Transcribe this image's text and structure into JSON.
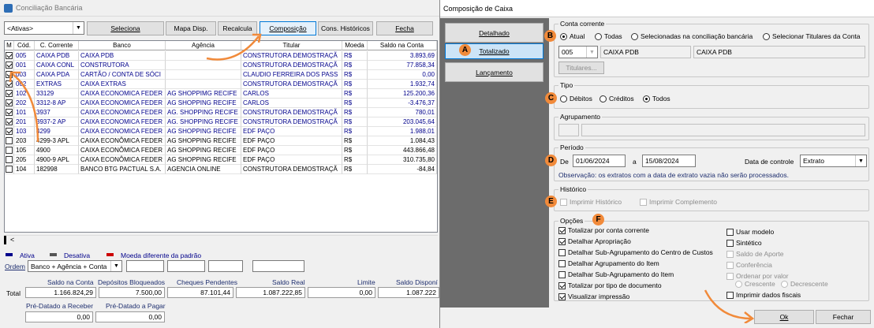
{
  "left_window": {
    "title": "Conciliação Bancária",
    "filter_select": "<Ativas>",
    "toolbar": {
      "seleciona": "Seleciona",
      "mapa_disp": "Mapa Disp.",
      "recalcula": "Recalcula",
      "composicao": "Composição",
      "cons_historicos": "Cons. Históricos",
      "fecha": "Fecha"
    },
    "grid": {
      "headers": [
        "M",
        "Cód.",
        "C. Corrente",
        "Banco",
        "Agência",
        "Titular",
        "Moeda",
        "Saldo na Conta"
      ],
      "rows": [
        {
          "checked": true,
          "cod": "005",
          "cc": "CAIXA PDB",
          "banco": "CAIXA PDB",
          "agencia": "",
          "titular": "CONSTRUTORA DEMOSTRAÇÃ",
          "moeda": "R$",
          "saldo": "3.893,69",
          "blue": true
        },
        {
          "checked": true,
          "cod": "001",
          "cc": "CAIXA CONL",
          "banco": "CONSTRUTORA",
          "agencia": "",
          "titular": "CONSTRUTORA DEMOSTRAÇÃ",
          "moeda": "R$",
          "saldo": "77.858,34",
          "blue": true
        },
        {
          "checked": true,
          "cod": "003",
          "cc": "CAIXA PDA",
          "banco": "CARTÃO / CONTA DE SÓCI",
          "agencia": "",
          "titular": "CLAUDIO  FERREIRA DOS PASS",
          "moeda": "R$",
          "saldo": "0,00",
          "blue": true
        },
        {
          "checked": true,
          "cod": "002",
          "cc": "EXTRAS",
          "banco": "CAIXA EXTRAS",
          "agencia": "",
          "titular": "CONSTRUTORA DEMOSTRAÇÃ",
          "moeda": "R$",
          "saldo": "1.932,74",
          "blue": true
        },
        {
          "checked": true,
          "cod": "102",
          "cc": "33129",
          "banco": "CAIXA ECONOMICA FEDER",
          "agencia": "AG SHOPPIMG RECIFE",
          "titular": "CARLOS",
          "moeda": "R$",
          "saldo": "125.200,36",
          "blue": true
        },
        {
          "checked": true,
          "cod": "202",
          "cc": "3312-8 AP",
          "banco": "CAIXA ECONOMICA FEDER",
          "agencia": "AG SHOPPING RECIFE",
          "titular": "CARLOS",
          "moeda": "R$",
          "saldo": "-3.476,37",
          "blue": true
        },
        {
          "checked": true,
          "cod": "101",
          "cc": "3937",
          "banco": "CAIXA ECONOMICA FEDER",
          "agencia": "AG. SHOPPING RECIFE",
          "titular": "CONSTRUTORA DEMOSTRAÇÃ",
          "moeda": "R$",
          "saldo": "780,01",
          "blue": true
        },
        {
          "checked": true,
          "cod": "201",
          "cc": "3937-2 AP",
          "banco": "CAIXA ECONOMICA FEDER",
          "agencia": "AG. SHOPPING RECIFE",
          "titular": "CONSTRUTORA DEMOSTRAÇÃ",
          "moeda": "R$",
          "saldo": "203.045,64",
          "blue": true
        },
        {
          "checked": true,
          "cod": "103",
          "cc": "4299",
          "banco": "CAIXA ECONOMICA FEDER",
          "agencia": "AG SHOPPING RECIFE",
          "titular": "EDF PAÇO",
          "moeda": "R$",
          "saldo": "1.988,01",
          "blue": true
        },
        {
          "checked": false,
          "cod": "203",
          "cc": "4299-3 APL",
          "banco": "CAIXA ECONÔMICA FEDER",
          "agencia": "AG SHOPPING RECIFE",
          "titular": "EDF PAÇO",
          "moeda": "R$",
          "saldo": "1.084,43",
          "blue": false
        },
        {
          "checked": false,
          "cod": "105",
          "cc": "4900",
          "banco": "CAIXA ECONÔMICA FEDER",
          "agencia": "AG SHOPPING RECIFE",
          "titular": "EDF PAÇO",
          "moeda": "R$",
          "saldo": "443.866,48",
          "blue": false
        },
        {
          "checked": false,
          "cod": "205",
          "cc": "4900-9 APL",
          "banco": "CAIXA ECONÔMICA FEDER",
          "agencia": "AG SHOPPING RECIFE",
          "titular": "EDF PAÇO",
          "moeda": "R$",
          "saldo": "310.735,80",
          "blue": false
        },
        {
          "checked": false,
          "cod": "104",
          "cc": "182998",
          "banco": "BANCO BTG PACTUAL S.A.",
          "agencia": "AGENCIA ONLINE",
          "titular": "CONSTRUTORA DEMOSTRAÇÃ",
          "moeda": "R$",
          "saldo": "-84,84",
          "blue": false
        }
      ]
    },
    "scroll_left": "<",
    "legend": {
      "ativa": "Ativa",
      "desativa": "Desativa",
      "moeda": "Moeda diferente da padrão"
    },
    "ordem_label": "Ordem",
    "ordem_value": "Banco + Agência + Conta",
    "totals": {
      "total_label": "Total",
      "saldo_na_conta_label": "Saldo na Conta",
      "saldo_na_conta": "1.166.824,29",
      "depositos_label": "Depósitos Bloqueados",
      "depositos": "7.500,00",
      "cheques_label": "Cheques Pendentes",
      "cheques": "87.101,44",
      "saldo_real_label": "Saldo Real",
      "saldo_real": "1.087.222,85",
      "limite_label": "Limite",
      "limite": "0,00",
      "saldo_disp_label": "Saldo Disponí",
      "saldo_disp": "1.087.222",
      "pre_receber_label": "Pré-Datado a Receber",
      "pre_receber": "0,00",
      "pre_pagar_label": "Pré-Datado a Pagar",
      "pre_pagar": "0,00"
    }
  },
  "dialog": {
    "title": "Composição de Caixa",
    "side_buttons": {
      "detalhado": "Detalhado",
      "totalizado": "Totalizado",
      "lancamento": "Lançamento"
    },
    "conta_corrente": {
      "label": "Conta corrente",
      "opt_atual": "Atual",
      "opt_todas": "Todas",
      "opt_selecionadas": "Selecionadas na conciliação bancária",
      "opt_titulares": "Selecionar Titulares da Conta",
      "code": "005",
      "name": "CAIXA PDB",
      "name2": "CAIXA PDB",
      "titulares_btn": "Titulares..."
    },
    "tipo": {
      "label": "Tipo",
      "debitos": "Débitos",
      "creditos": "Créditos",
      "todos": "Todos"
    },
    "agrupamento": {
      "label": "Agrupamento"
    },
    "periodo": {
      "label": "Período",
      "de": "De",
      "start": "01/06/2024",
      "a": "a",
      "end": "15/08/2024",
      "data_controle_label": "Data de controle",
      "data_controle": "Extrato",
      "observacao": "Observação: os extratos com a data de extrato vazia não serão processados."
    },
    "historico": {
      "label": "Histórico",
      "imprimir_historico": "Imprimir Histórico",
      "imprimir_complemento": "Imprimir Complemento"
    },
    "opcoes": {
      "label": "Opções",
      "left": [
        {
          "label": "Totalizar por conta corrente",
          "checked": true,
          "disabled": false
        },
        {
          "label": "Detalhar Apropriação",
          "checked": true,
          "disabled": false
        },
        {
          "label": "Detalhar Sub-Agrupamento do Centro de Custos",
          "checked": false,
          "disabled": false
        },
        {
          "label": "Detalhar Agrupamento do Item",
          "checked": false,
          "disabled": false
        },
        {
          "label": "Detalhar Sub-Agrupamento do Item",
          "checked": false,
          "disabled": false
        },
        {
          "label": "Totalizar por tipo de documento",
          "checked": true,
          "disabled": false
        },
        {
          "label": "Visualizar impressão",
          "checked": true,
          "disabled": false
        }
      ],
      "right": [
        {
          "label": "Usar modelo",
          "checked": false,
          "disabled": false
        },
        {
          "label": "Sintético",
          "checked": false,
          "disabled": false
        },
        {
          "label": "Saldo de Aporte",
          "checked": false,
          "disabled": true
        },
        {
          "label": "Conferência",
          "checked": false,
          "disabled": true
        },
        {
          "label": "Ordenar por valor",
          "checked": false,
          "disabled": true
        }
      ],
      "crescente": "Crescente",
      "decrescente": "Decrescente",
      "imprimir_fiscais": "Imprimir dados fiscais"
    },
    "ok": "Ok",
    "fechar": "Fechar"
  },
  "badges": {
    "a": "A",
    "b": "B",
    "c": "C",
    "d": "D",
    "e": "E",
    "f": "F"
  },
  "colors": {
    "annotation": "#f18a3a",
    "selected_btn": "#cce4f7",
    "link_blue": "#00008b"
  }
}
